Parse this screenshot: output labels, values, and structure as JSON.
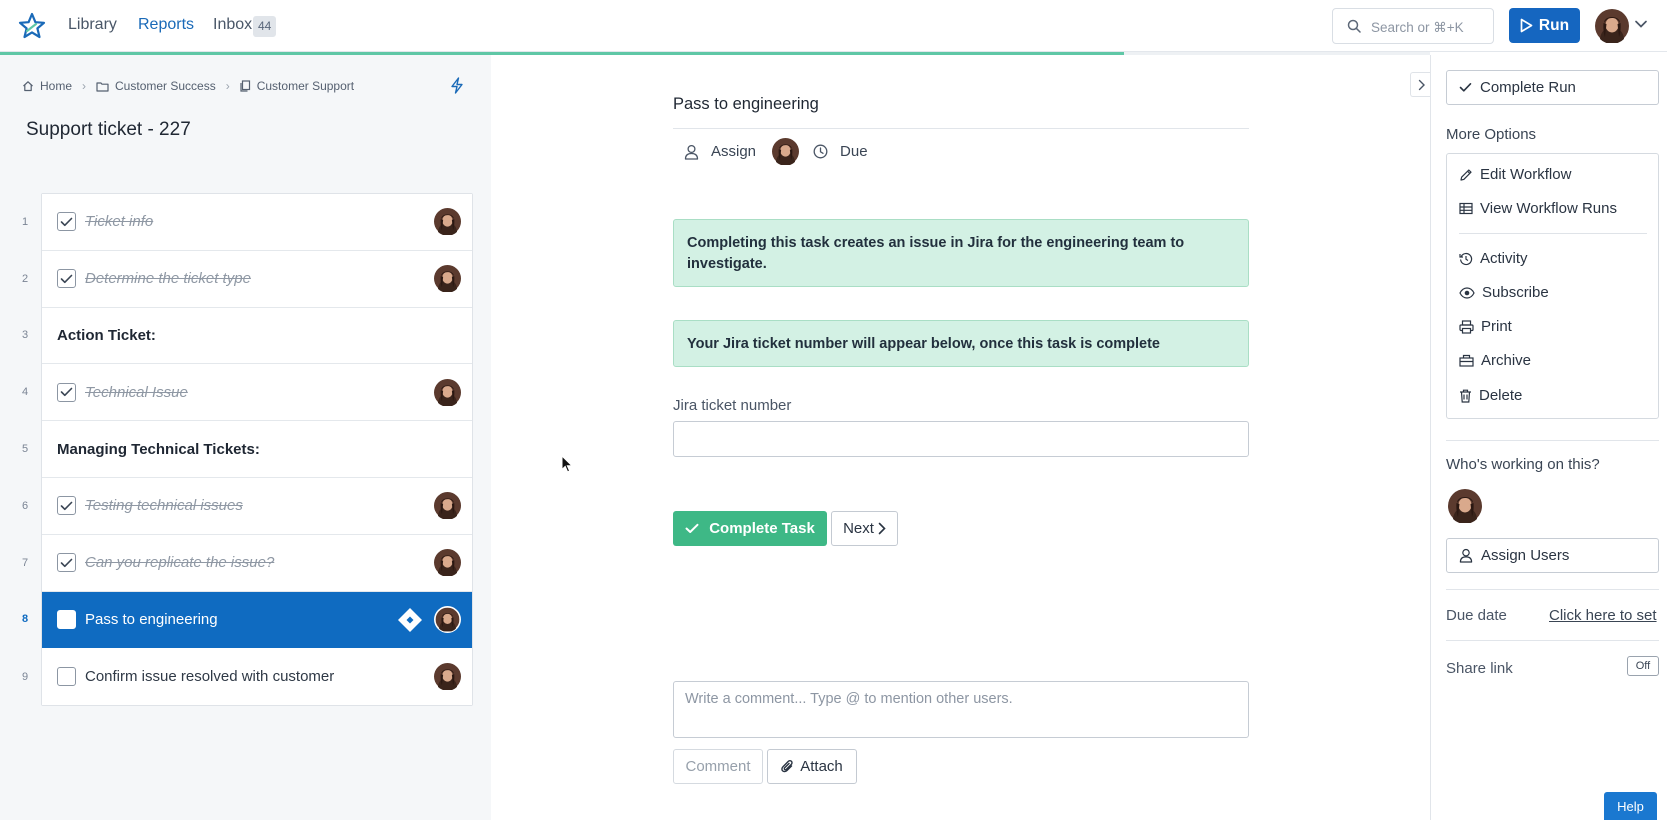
{
  "nav": {
    "links": [
      "Library",
      "Reports",
      "Inbox"
    ],
    "active": "Reports",
    "inbox_count": "44",
    "search_placeholder": "Search or ⌘+K",
    "run_label": "Run"
  },
  "progress": {
    "fraction": 0.786
  },
  "breadcrumb": [
    {
      "label": "Home",
      "icon": "home-icon"
    },
    {
      "label": "Customer Success",
      "icon": "folder-icon"
    },
    {
      "label": "Customer Support",
      "icon": "document-icon"
    }
  ],
  "run_title": "Support ticket - 227",
  "tasks": [
    {
      "num": "1",
      "label": "Ticket info",
      "type": "task",
      "done": true
    },
    {
      "num": "2",
      "label": "Determine the ticket type",
      "type": "task",
      "done": true
    },
    {
      "num": "3",
      "label": "Action Ticket:",
      "type": "heading"
    },
    {
      "num": "4",
      "label": "Technical Issue",
      "type": "task",
      "done": true
    },
    {
      "num": "5",
      "label": "Managing Technical Tickets:",
      "type": "heading"
    },
    {
      "num": "6",
      "label": "Testing technical issues",
      "type": "task",
      "done": true
    },
    {
      "num": "7",
      "label": "Can you replicate the issue?",
      "type": "task",
      "done": true
    },
    {
      "num": "8",
      "label": "Pass to engineering",
      "type": "task",
      "done": false,
      "selected": true
    },
    {
      "num": "9",
      "label": "Confirm issue resolved with customer",
      "type": "task",
      "done": false
    }
  ],
  "task_detail": {
    "title": "Pass to engineering",
    "assign_label": "Assign",
    "due_label": "Due",
    "banner1": "Completing this task creates an issue in Jira for the engineering team to investigate.",
    "banner2": "Your Jira ticket number will appear below, once this task is complete",
    "field_label": "Jira ticket number",
    "field_value": "",
    "complete_label": "Complete Task",
    "next_label": "Next",
    "comment_placeholder": "Write a comment... Type @ to mention other users.",
    "comment_label": "Comment",
    "attach_label": "Attach"
  },
  "sidebar": {
    "complete_run_label": "Complete Run",
    "more_options_heading": "More Options",
    "options": [
      {
        "label": "Edit Workflow",
        "icon": "pencil-icon"
      },
      {
        "label": "View Workflow Runs",
        "icon": "table-icon"
      },
      {
        "label": "Activity",
        "icon": "history-icon"
      },
      {
        "label": "Subscribe",
        "icon": "eye-icon"
      },
      {
        "label": "Print",
        "icon": "printer-icon"
      },
      {
        "label": "Archive",
        "icon": "archive-icon"
      },
      {
        "label": "Delete",
        "icon": "trash-icon"
      }
    ],
    "working_heading": "Who's working on this?",
    "assign_users_label": "Assign Users",
    "due_date_label": "Due date",
    "due_date_link": "Click here to set",
    "share_link_label": "Share link",
    "share_toggle": "Off"
  },
  "help_label": "Help",
  "colors": {
    "primary": "#1566c0",
    "selected_row": "#0f6bc1",
    "success": "#3eb886",
    "banner_bg": "#d3f1e4",
    "progress": "#5fc7a6"
  }
}
